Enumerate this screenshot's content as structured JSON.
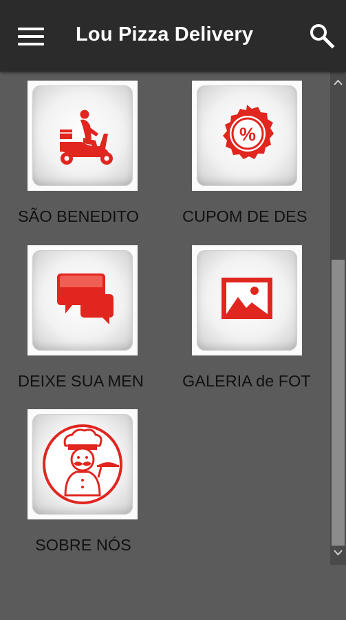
{
  "header": {
    "title": "Lou Pizza Delivery",
    "menu_icon": "menu-icon",
    "search_icon": "search-icon"
  },
  "tiles": [
    {
      "label": "SÃO BENEDITO",
      "icon": "delivery-scooter-icon"
    },
    {
      "label": "CUPOM DE DES",
      "icon": "discount-badge-icon"
    },
    {
      "label": "DEIXE SUA MEN",
      "icon": "chat-bubbles-icon"
    },
    {
      "label": "GALERIA de FOT",
      "icon": "gallery-image-icon"
    },
    {
      "label": "SOBRE NÓS",
      "icon": "chef-icon"
    }
  ],
  "colors": {
    "accent": "#e0261f",
    "appbar": "#2b2b2b",
    "background": "#5b5b5b"
  }
}
